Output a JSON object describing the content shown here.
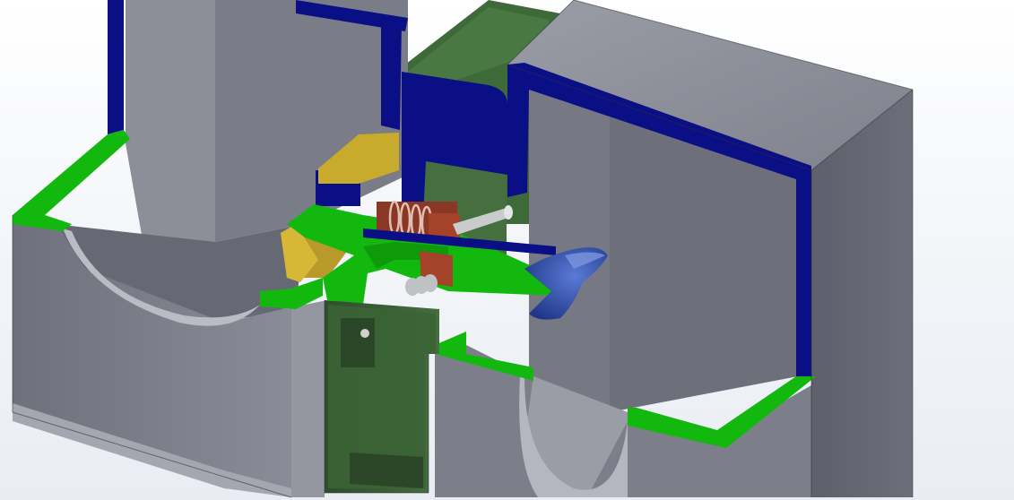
{
  "scene": {
    "kind": "3D CAD section view",
    "background_color": "#eef1f5",
    "colors": {
      "cut_face_green": "#12b80e",
      "cut_face_blue": "#0b0f86",
      "body_gray_light": "#8d909b",
      "body_gray_dark": "#5c5f69",
      "body_gray_mid": "#767984",
      "translucent_green": "#3f6f3a",
      "brass_yellow": "#c8aa2c",
      "spring_red": "#a5422a",
      "shaft_steel": "#c9cbcd",
      "blue_blade": "#2a48a8"
    }
  }
}
